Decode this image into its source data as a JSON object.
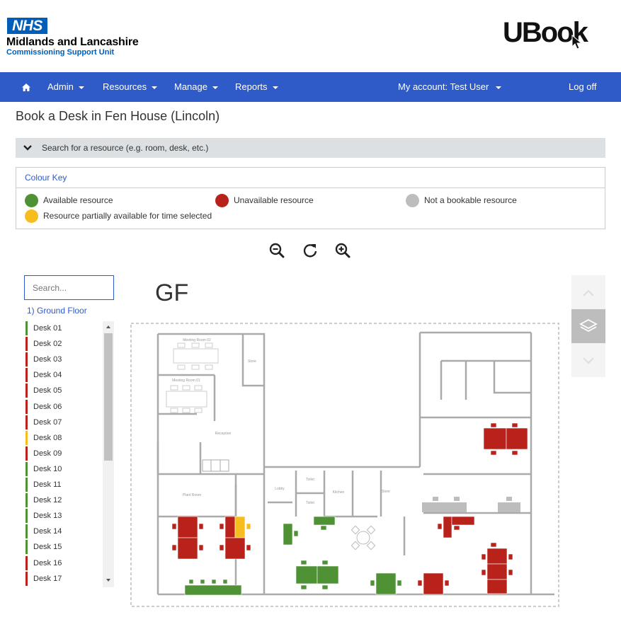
{
  "header": {
    "nhs_logo": "NHS",
    "org_name": "Midlands and Lancashire",
    "org_sub": "Commissioning Support Unit",
    "app_logo": "UBook"
  },
  "nav": {
    "home_icon": "home-icon",
    "items": [
      {
        "label": "Admin"
      },
      {
        "label": "Resources"
      },
      {
        "label": "Manage"
      },
      {
        "label": "Reports"
      }
    ],
    "account_label": "My account: Test User",
    "logoff_label": "Log off"
  },
  "page_title": "Book a Desk in Fen House (Lincoln)",
  "search_bar": {
    "label": "Search for a resource (e.g. room, desk, etc.)"
  },
  "colour_key": {
    "title": "Colour Key",
    "items": [
      {
        "label": "Available resource",
        "color": "#4f9236"
      },
      {
        "label": "Unavailable resource",
        "color": "#b8221a"
      },
      {
        "label": "Not a bookable resource",
        "color": "#bdbdbd"
      },
      {
        "label": "Resource partially available for time selected",
        "color": "#f5be1e"
      }
    ]
  },
  "zoom": {
    "zoom_out_icon": "zoom-out-icon",
    "reset_icon": "refresh-icon",
    "zoom_in_icon": "zoom-in-icon"
  },
  "sidebar": {
    "search_placeholder": "Search...",
    "floor_link": "1) Ground Floor",
    "desks": [
      {
        "label": "Desk 01",
        "status": "available"
      },
      {
        "label": "Desk 02",
        "status": "unavailable"
      },
      {
        "label": "Desk 03",
        "status": "unavailable"
      },
      {
        "label": "Desk 04",
        "status": "unavailable"
      },
      {
        "label": "Desk 05",
        "status": "unavailable"
      },
      {
        "label": "Desk 06",
        "status": "unavailable"
      },
      {
        "label": "Desk 07",
        "status": "unavailable"
      },
      {
        "label": "Desk 08",
        "status": "partial"
      },
      {
        "label": "Desk 09",
        "status": "unavailable"
      },
      {
        "label": "Desk 10",
        "status": "available"
      },
      {
        "label": "Desk 11",
        "status": "available"
      },
      {
        "label": "Desk 12",
        "status": "available"
      },
      {
        "label": "Desk 13",
        "status": "available"
      },
      {
        "label": "Desk 14",
        "status": "available"
      },
      {
        "label": "Desk 15",
        "status": "available"
      },
      {
        "label": "Desk 16",
        "status": "unavailable"
      },
      {
        "label": "Desk 17",
        "status": "unavailable"
      }
    ]
  },
  "map": {
    "floor_label": "GF",
    "room_labels": {
      "meeting_room_02": "Meeting Room 02",
      "meeting_room_01": "Meeting Room 01",
      "store1": "Store",
      "reception": "Reception",
      "plant_room": "Plant Room",
      "lobby": "Lobby",
      "toilet1": "Toilet",
      "toilet2": "Toilet",
      "kitchen": "Kitchen",
      "store2": "Store"
    }
  },
  "layers": {
    "up_icon": "chevron-up-icon",
    "layers_icon": "layers-icon",
    "down_icon": "chevron-down-icon"
  }
}
